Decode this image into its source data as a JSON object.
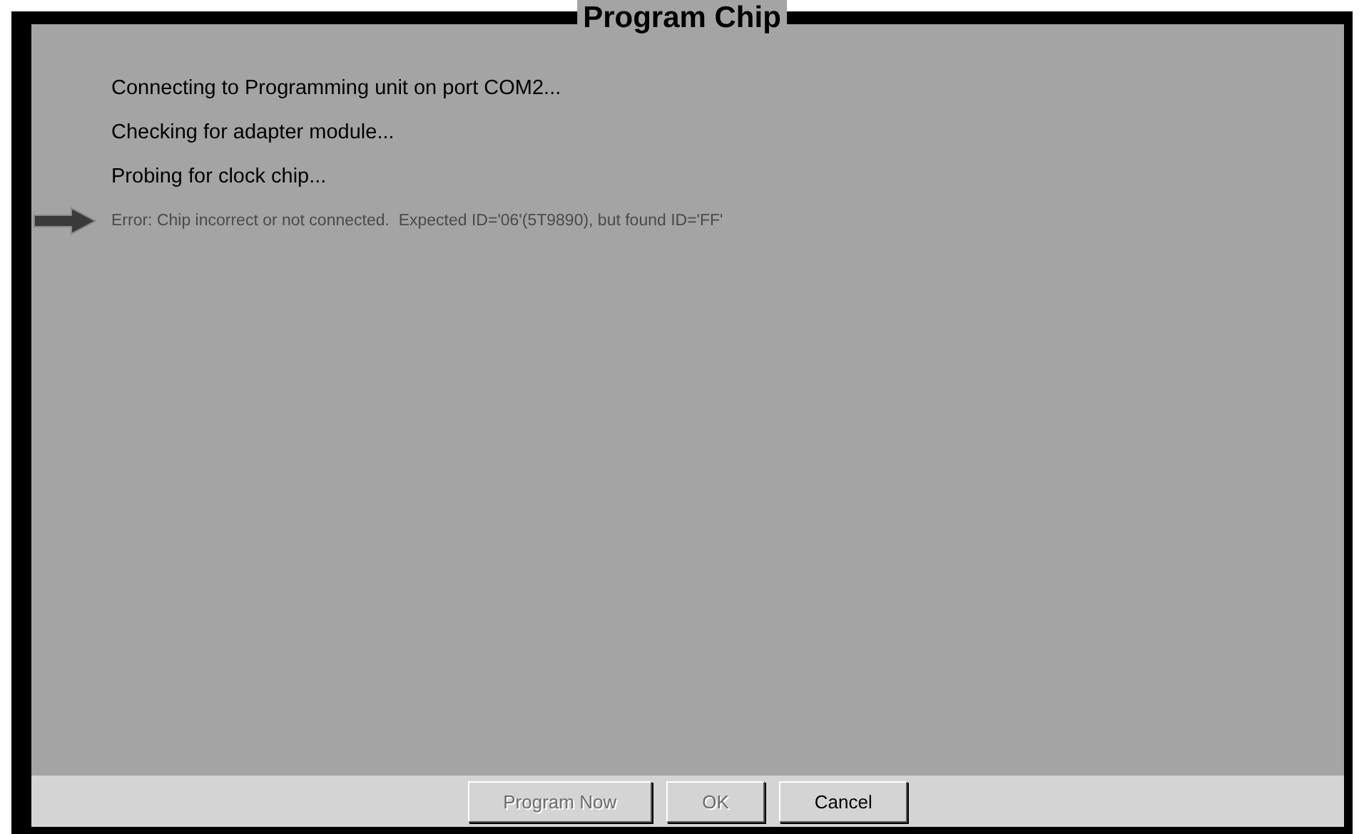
{
  "window": {
    "title": "Program Chip"
  },
  "messages": [
    {
      "kind": "info",
      "text": "Connecting to Programming unit on port COM2..."
    },
    {
      "kind": "info",
      "text": "Checking for adapter module..."
    },
    {
      "kind": "info",
      "text": "Probing for clock chip..."
    },
    {
      "kind": "error",
      "text": "Error: Chip incorrect or not connected.  Expected ID='06'(5T9890), but found ID='FF'"
    }
  ],
  "buttons": [
    {
      "label": "Program Now",
      "disabled": true
    },
    {
      "label": "OK",
      "disabled": true
    },
    {
      "label": "Cancel",
      "disabled": false
    }
  ]
}
